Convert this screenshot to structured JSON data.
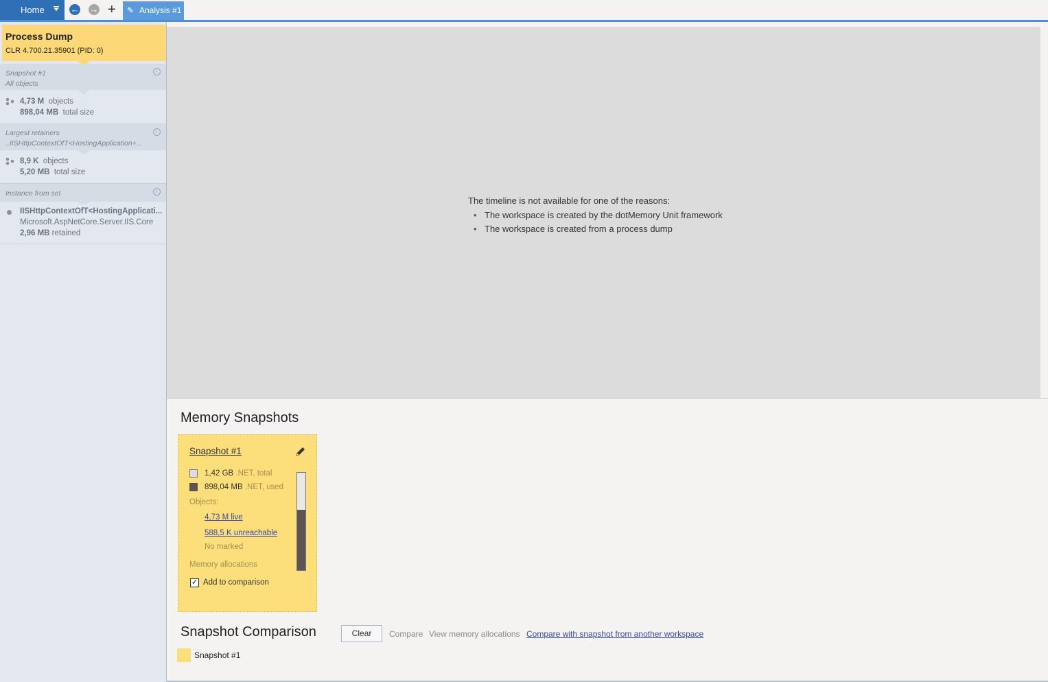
{
  "toolbar": {
    "home_label": "Home",
    "back_icon": "arrow-left-icon",
    "forward_icon": "arrow-right-icon",
    "add_icon": "plus-icon",
    "tab_label": "Analysis #1"
  },
  "sidebar": {
    "process": {
      "title": "Process Dump",
      "subtitle": "CLR 4.700.21.35901 (PID: 0)"
    },
    "sections": [
      {
        "head_line1": "Snapshot #1",
        "head_line2": "All objects",
        "count_value": "4,73 M",
        "count_unit": "objects",
        "size_value": "898,04 MB",
        "size_unit": "total size"
      },
      {
        "head_line1": "Largest retainers",
        "head_line2": "..IISHttpContextOfT<HostingApplication+...",
        "count_value": "8,9 K",
        "count_unit": "objects",
        "size_value": "5,20 MB",
        "size_unit": "total size"
      },
      {
        "head_line1": "Instance from set",
        "name": "IISHttpContextOfT<HostingApplicati...",
        "assembly": "Microsoft.AspNetCore.Server.IIS.Core",
        "size_value": "2,96 MB",
        "size_unit": "retained"
      }
    ]
  },
  "timeline": {
    "message": "The timeline is not available for one of the reasons:",
    "reasons": [
      "The workspace is created by the dotMemory Unit framework",
      "The workspace is created from a process dump"
    ]
  },
  "memory_snapshots": {
    "title": "Memory Snapshots",
    "card": {
      "title": "Snapshot #1",
      "total_value": "1,42 GB",
      "total_label": ".NET, total",
      "used_value": "898,04 MB",
      "used_label": ".NET, used",
      "objects_label": "Objects:",
      "live_link": "4,73 M live",
      "unreachable_link": "588,5 K unreachable",
      "marked_label": "No marked",
      "allocations_label": "Memory allocations",
      "comparison_label": "Add to comparison",
      "comparison_checked": true,
      "used_fraction": 0.62,
      "colors": {
        "card": "#fcdf7a",
        "used": "#5e5353",
        "total": "#dcdcdc"
      }
    }
  },
  "snapshot_comparison": {
    "title": "Snapshot Comparison",
    "clear_label": "Clear",
    "compare_label": "Compare",
    "view_alloc_label": "View memory allocations",
    "other_workspace_link": "Compare with snapshot from another workspace",
    "items": [
      "Snapshot #1"
    ]
  }
}
